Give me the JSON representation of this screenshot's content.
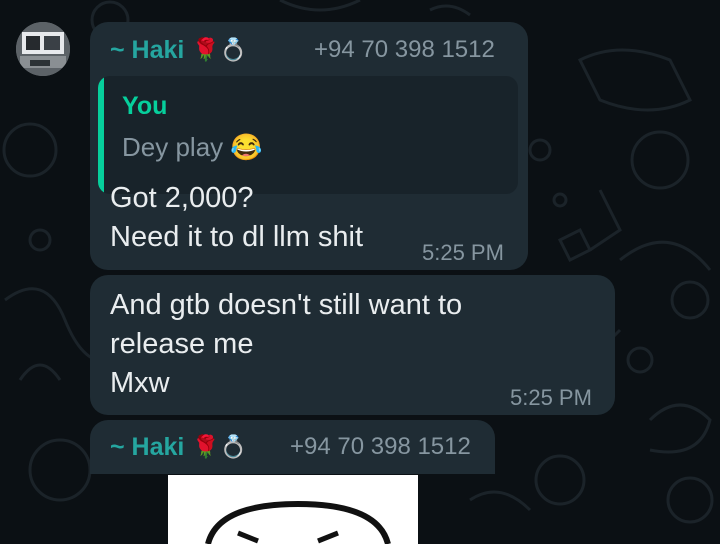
{
  "messages": [
    {
      "sender": "~ Haki",
      "sender_emoji": "🌹💍",
      "phone": "+94 70 398 1512",
      "reply": {
        "author": "You",
        "text": "Dey play 😂"
      },
      "lines": [
        "Got 2,000?",
        "Need it to dl llm shit"
      ],
      "time": "5:25 PM"
    },
    {
      "lines": [
        "And gtb doesn't still want to",
        "release me",
        "Mxw"
      ],
      "time": "5:25 PM"
    },
    {
      "sender": "~ Haki",
      "sender_emoji": "🌹💍",
      "phone": "+94 70 398 1512"
    }
  ],
  "icons": {
    "avatar": "contact-avatar",
    "image": "sticker-image"
  },
  "colors": {
    "background": "#0b1014",
    "bubble": "#1f2c34",
    "quote_bar": "#06cf9c",
    "sender": "#25a6a0",
    "text": "#e9edef",
    "meta": "#8696a0"
  }
}
